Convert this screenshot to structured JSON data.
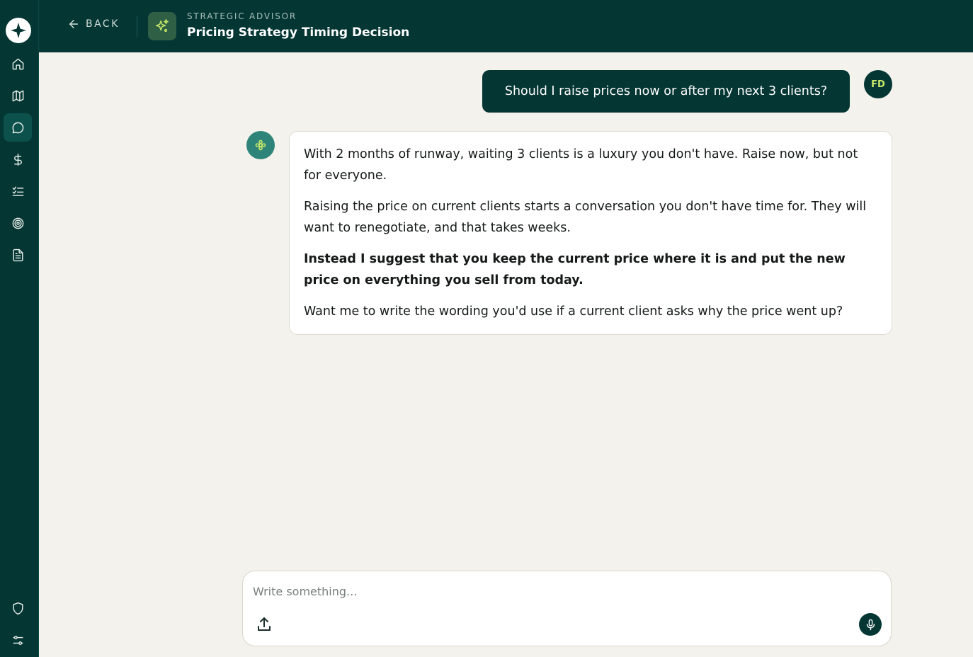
{
  "header": {
    "back_label": "BACK",
    "subtitle": "STRATEGIC ADVISOR",
    "title": "Pricing Strategy Timing Decision"
  },
  "sidebar": {
    "items": [
      {
        "icon": "home-icon"
      },
      {
        "icon": "map-icon"
      },
      {
        "icon": "chat-icon",
        "active": true
      },
      {
        "icon": "dollar-icon"
      },
      {
        "icon": "checklist-icon"
      },
      {
        "icon": "target-icon"
      },
      {
        "icon": "document-icon"
      }
    ],
    "bottom_items": [
      {
        "icon": "shield-icon"
      },
      {
        "icon": "settings-sliders-icon"
      }
    ]
  },
  "conversation": {
    "user_initials": "FD",
    "user_message": "Should I raise prices now or after my next 3 clients?",
    "assistant_paragraphs": [
      "With 2 months of runway, waiting 3 clients is a luxury you don't have. Raise now, but not for everyone.",
      "Raising the price on current clients starts a conversation you don't have time for. They will want to renegotiate, and that takes weeks.",
      "Instead I suggest that you keep the current price where it is and put the new price on everything you sell from today.",
      "Want me to write the wording you'd use if a current client asks why the price went up?"
    ]
  },
  "composer": {
    "placeholder": "Write something..."
  },
  "colors": {
    "primary_dark": "#043634",
    "accent_lime": "#c8e96a",
    "background": "#f4f2ed",
    "assistant_avatar": "#2e8478"
  }
}
